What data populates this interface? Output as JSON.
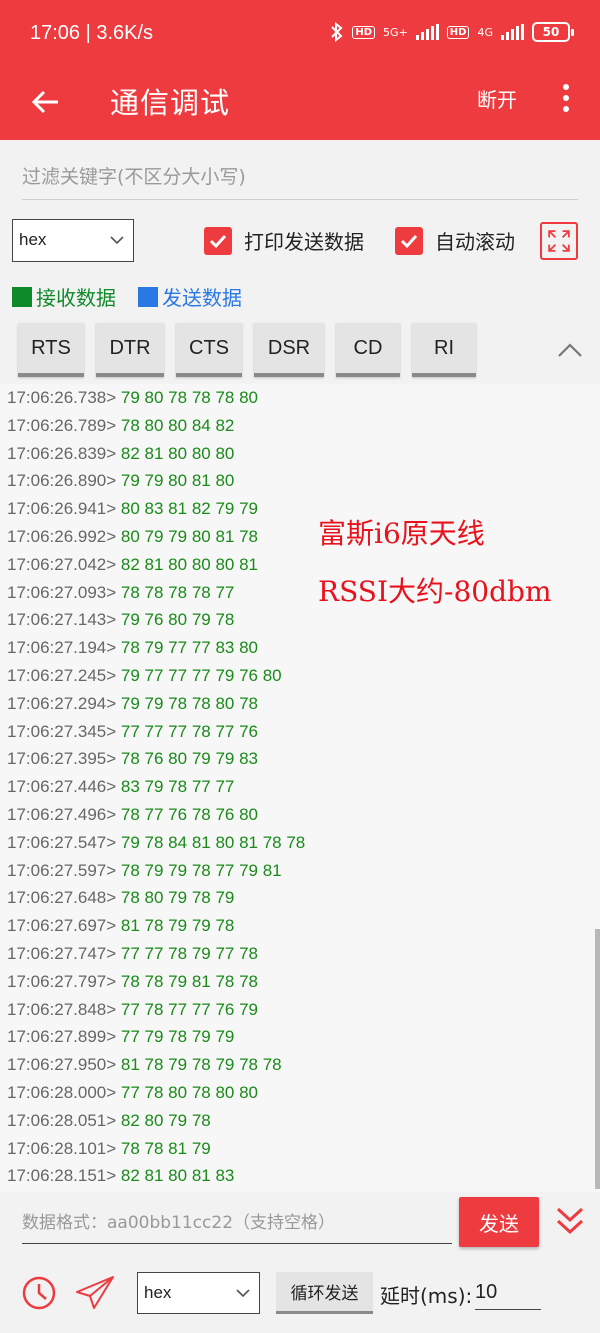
{
  "status_bar": {
    "time": "17:06 | 3.6K/s",
    "net1": "5G+",
    "net2": "4G",
    "hd": "HD",
    "battery": "50"
  },
  "app_bar": {
    "title": "通信调试",
    "disconnect_label": "断开"
  },
  "filter": {
    "placeholder": "过滤关键字(不区分大小写)"
  },
  "options": {
    "format_value": "hex",
    "print_sent_label": "打印发送数据",
    "print_sent_checked": true,
    "auto_scroll_label": "自动滚动",
    "auto_scroll_checked": true
  },
  "legend": {
    "received_label": "接收数据",
    "received_color": "#0f8a2b",
    "sent_label": "发送数据",
    "sent_color": "#2a78e4"
  },
  "signals": [
    "RTS",
    "DTR",
    "CTS",
    "DSR",
    "CD",
    "RI"
  ],
  "log": [
    {
      "ts": "17:06:26.738> ",
      "data": "79 80 78 78 78 80"
    },
    {
      "ts": "17:06:26.789> ",
      "data": "78 80 80 84 82"
    },
    {
      "ts": "17:06:26.839> ",
      "data": "82 81 80 80 80"
    },
    {
      "ts": "17:06:26.890> ",
      "data": "79 79 80 81 80"
    },
    {
      "ts": "17:06:26.941> ",
      "data": "80 83 81 82 79 79"
    },
    {
      "ts": "17:06:26.992> ",
      "data": "80 79 79 80 81 78"
    },
    {
      "ts": "17:06:27.042> ",
      "data": "82 81 80 80 80 81"
    },
    {
      "ts": "17:06:27.093> ",
      "data": "78 78 78 78 77"
    },
    {
      "ts": "17:06:27.143> ",
      "data": "79 76 80 79 78"
    },
    {
      "ts": "17:06:27.194> ",
      "data": "78 79 77 77 83 80"
    },
    {
      "ts": "17:06:27.245> ",
      "data": "79 77 77 77 79 76 80"
    },
    {
      "ts": "17:06:27.294> ",
      "data": "79 79 78 78 80 78"
    },
    {
      "ts": "17:06:27.345> ",
      "data": "77 77 77 78 77 76"
    },
    {
      "ts": "17:06:27.395> ",
      "data": "78 76 80 79 79 83"
    },
    {
      "ts": "17:06:27.446> ",
      "data": "83 79 78 77 77"
    },
    {
      "ts": "17:06:27.496> ",
      "data": "78 77 76 78 76 80"
    },
    {
      "ts": "17:06:27.547> ",
      "data": "79 78 84 81 80 81 78 78"
    },
    {
      "ts": "17:06:27.597> ",
      "data": "78 79 79 78 77 79 81"
    },
    {
      "ts": "17:06:27.648> ",
      "data": "78 80 79 78 79"
    },
    {
      "ts": "17:06:27.697> ",
      "data": "81 78 79 79 78"
    },
    {
      "ts": "17:06:27.747> ",
      "data": "77 77 78 79 77 78"
    },
    {
      "ts": "17:06:27.797> ",
      "data": "78 78 79 81 78 78"
    },
    {
      "ts": "17:06:27.848> ",
      "data": "77 78 77 77 76 79"
    },
    {
      "ts": "17:06:27.899> ",
      "data": "77 79 78 79 79"
    },
    {
      "ts": "17:06:27.950> ",
      "data": "81 78 79 78 79 78 78"
    },
    {
      "ts": "17:06:28.000> ",
      "data": "77 78 80 78 80 80"
    },
    {
      "ts": "17:06:28.051> ",
      "data": "82 80 79 78"
    },
    {
      "ts": "17:06:28.101> ",
      "data": "78 78 81 79"
    },
    {
      "ts": "17:06:28.151> ",
      "data": "82 81 80 81 83"
    }
  ],
  "annotation": {
    "line1": "富斯i6原天线",
    "line2": "RSSI大约-80dbm"
  },
  "bottom": {
    "send_placeholder": "数据格式：aa00bb11cc22（支持空格）",
    "send_label": "发送",
    "format_value": "hex",
    "loop_send_label": "循环发送",
    "delay_label": "延时(ms):",
    "delay_value": "10"
  }
}
